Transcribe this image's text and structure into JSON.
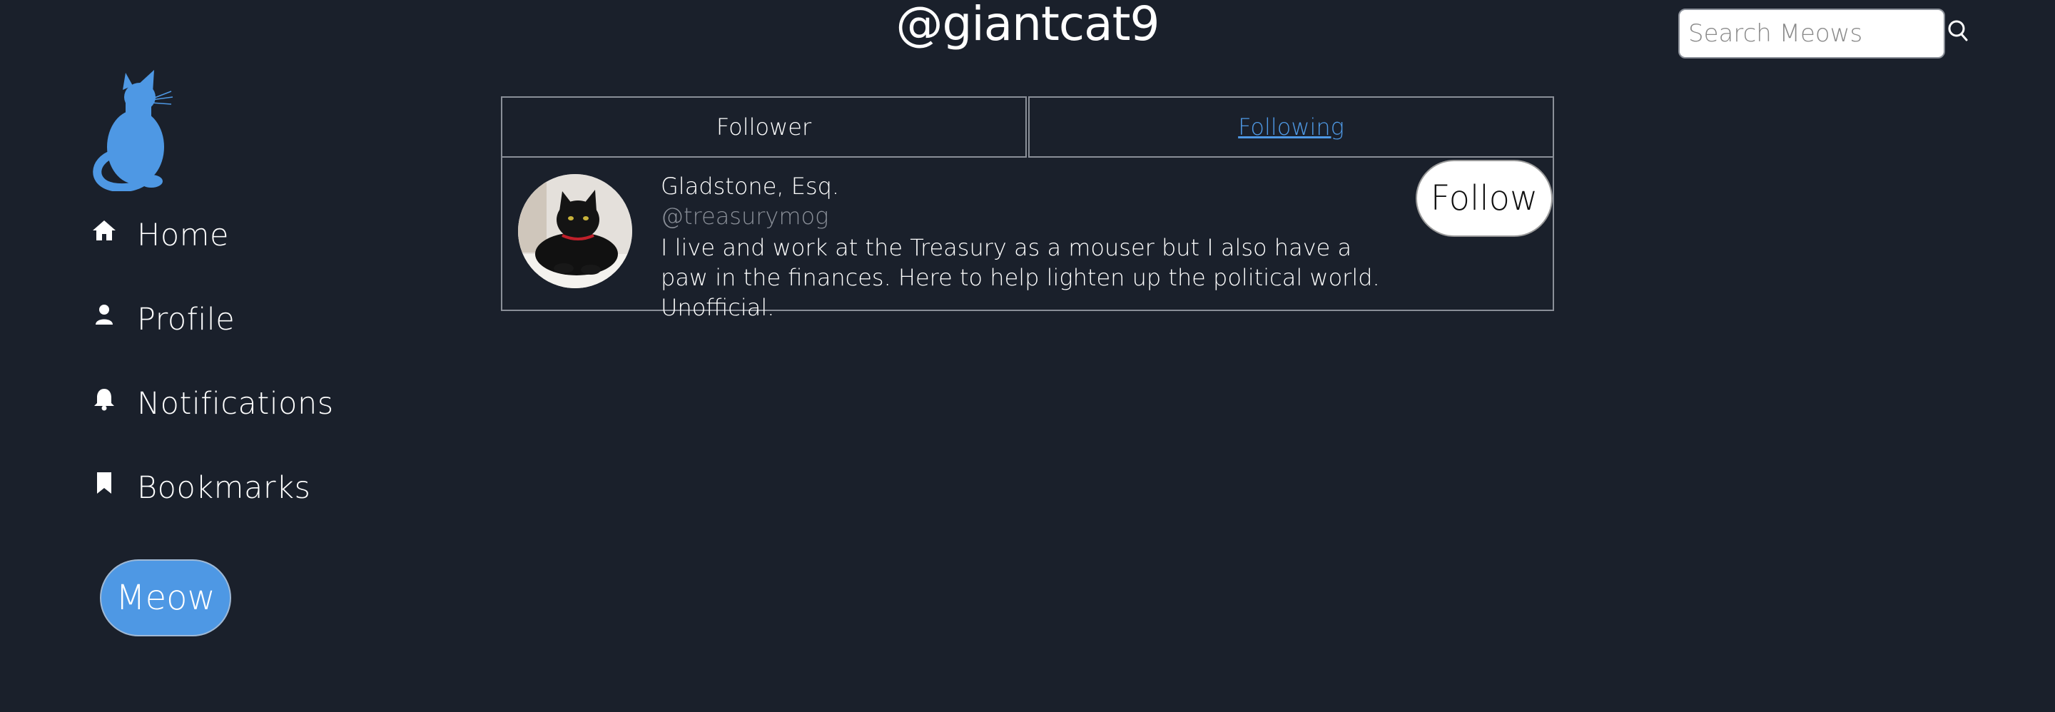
{
  "header": {
    "title": "@giantcat9"
  },
  "search": {
    "placeholder": "Search Meows",
    "value": "",
    "icon": "search-icon"
  },
  "sidebar": {
    "logo": "cat-logo",
    "items": [
      {
        "label": "Home",
        "icon": "home-icon"
      },
      {
        "label": "Profile",
        "icon": "person-icon"
      },
      {
        "label": "Notifications",
        "icon": "bell-icon"
      },
      {
        "label": "Bookmarks",
        "icon": "bookmark-icon"
      }
    ],
    "meow_label": "Meow"
  },
  "tabs": [
    {
      "label": "Follower",
      "active": false
    },
    {
      "label": "Following",
      "active": true
    }
  ],
  "users": [
    {
      "name": "Gladstone, Esq.",
      "handle": "@treasurymog",
      "bio": "I live and work at the Treasury as a mouser but I also have a paw in the finances. Here to help lighten up the political world. Unofficial.",
      "follow_label": "Follow"
    }
  ],
  "colors": {
    "background": "#1a202b",
    "accent": "#4e98e4",
    "border": "#8a8f98",
    "muted_text": "#8a8f98"
  }
}
